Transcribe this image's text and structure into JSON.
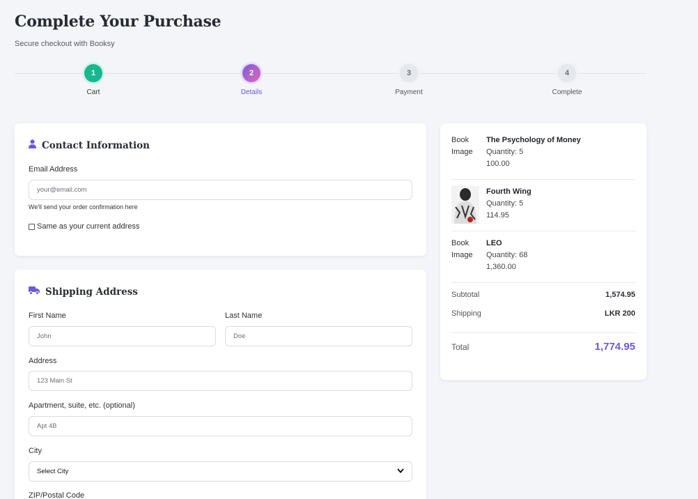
{
  "header": {
    "title": "Complete Your Purchase",
    "subtitle": "Secure checkout with Booksy"
  },
  "stepper": {
    "steps": [
      {
        "number": "1",
        "label": "Cart",
        "state": "done"
      },
      {
        "number": "2",
        "label": "Details",
        "state": "active"
      },
      {
        "number": "3",
        "label": "Payment",
        "state": "todo"
      },
      {
        "number": "4",
        "label": "Complete",
        "state": "todo"
      }
    ]
  },
  "contact": {
    "title": "Contact Information",
    "icon": "user-icon",
    "email_label": "Email Address",
    "email_placeholder": "your@email.com",
    "email_hint": "We'll send your order confirmation here",
    "same_address_label": "Same as your current address"
  },
  "shipping": {
    "title": "Shipping Address",
    "icon": "truck-icon",
    "first_name_label": "First Name",
    "first_name_placeholder": "John",
    "last_name_label": "Last Name",
    "last_name_placeholder": "Doe",
    "address_label": "Address",
    "address_placeholder": "123 Main St",
    "apartment_label": "Apartment, suite, etc. (optional)",
    "apartment_placeholder": "Apt 4B",
    "city_label": "City",
    "city_selected": "Select City",
    "zip_label": "ZIP/Postal Code"
  },
  "summary": {
    "items": [
      {
        "image_alt": "Book Image",
        "title": "The Psychology of Money",
        "quantity": "Quantity: 5",
        "price": "100.00"
      },
      {
        "image_alt": "",
        "title": "Fourth Wing",
        "quantity": "Quantity: 5",
        "price": "114.95"
      },
      {
        "image_alt": "Book Image",
        "title": "LEO",
        "quantity": "Quantity: 68",
        "price": "1,360.00"
      }
    ],
    "subtotal_label": "Subtotal",
    "subtotal_value": "1,574.95",
    "shipping_label": "Shipping",
    "shipping_value": "LKR 200",
    "total_label": "Total",
    "total_value": "1,774.95"
  },
  "colors": {
    "accent": "#6d5ad8",
    "success": "#17b890",
    "background": "#f4f5f9"
  }
}
